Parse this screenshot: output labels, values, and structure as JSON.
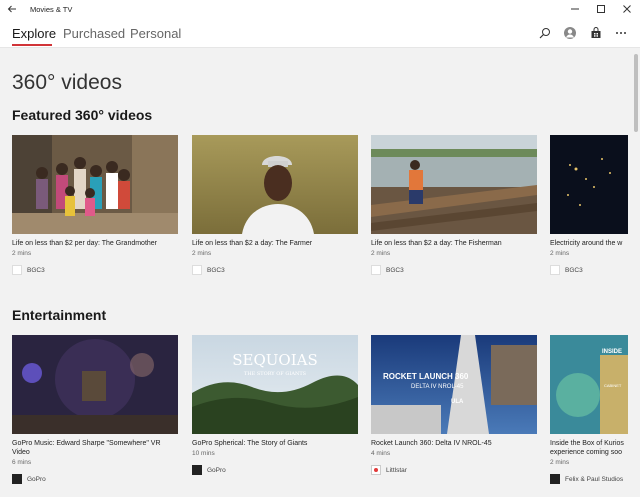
{
  "window": {
    "title": "Movies & TV"
  },
  "tabs": [
    {
      "label": "Explore",
      "active": true
    },
    {
      "label": "Purchased",
      "active": false
    },
    {
      "label": "Personal",
      "active": false
    }
  ],
  "toolbar_icons": [
    "search-icon",
    "account-icon",
    "store-icon",
    "more-icon"
  ],
  "page": {
    "title": "360° videos"
  },
  "sections": [
    {
      "title": "Featured 360° videos",
      "items": [
        {
          "title": "Life on less than $2 per day: The Grandmother",
          "duration": "2 mins",
          "provider": "BGC3"
        },
        {
          "title": "Life on less than $2 a day: The Farmer",
          "duration": "2 mins",
          "provider": "BGC3"
        },
        {
          "title": "Life on less than $2 a day: The Fisherman",
          "duration": "2 mins",
          "provider": "BGC3"
        },
        {
          "title": "Electricity around the w",
          "duration": "2 mins",
          "provider": "BGC3"
        }
      ]
    },
    {
      "title": "Entertainment",
      "items": [
        {
          "title": "GoPro Music: Edward Sharpe \"Somewhere\" VR Video",
          "duration": "6 mins",
          "provider": "GoPro"
        },
        {
          "title": "GoPro Spherical: The Story of Giants",
          "duration": "10 mins",
          "provider": "GoPro",
          "thumb_title": "SEQUOIAS",
          "thumb_subtitle": "THE STORY OF GIANTS"
        },
        {
          "title": "Rocket Launch 360: Delta IV NROL-45",
          "duration": "4 mins",
          "provider": "Littlstar",
          "thumb_title": "ROCKET LAUNCH 360",
          "thumb_subtitle": "DELTA IV NROL-45",
          "thumb_brand": "ULA"
        },
        {
          "title": "Inside the Box of Kurios experience coming soo",
          "duration": "2 mins",
          "provider": "Felix & Paul Studios",
          "thumb_title": "INSIDE",
          "thumb_subtitle": "CABINET"
        }
      ]
    }
  ],
  "colors": {
    "accent": "#d13438",
    "background": "#f2f2f2"
  }
}
